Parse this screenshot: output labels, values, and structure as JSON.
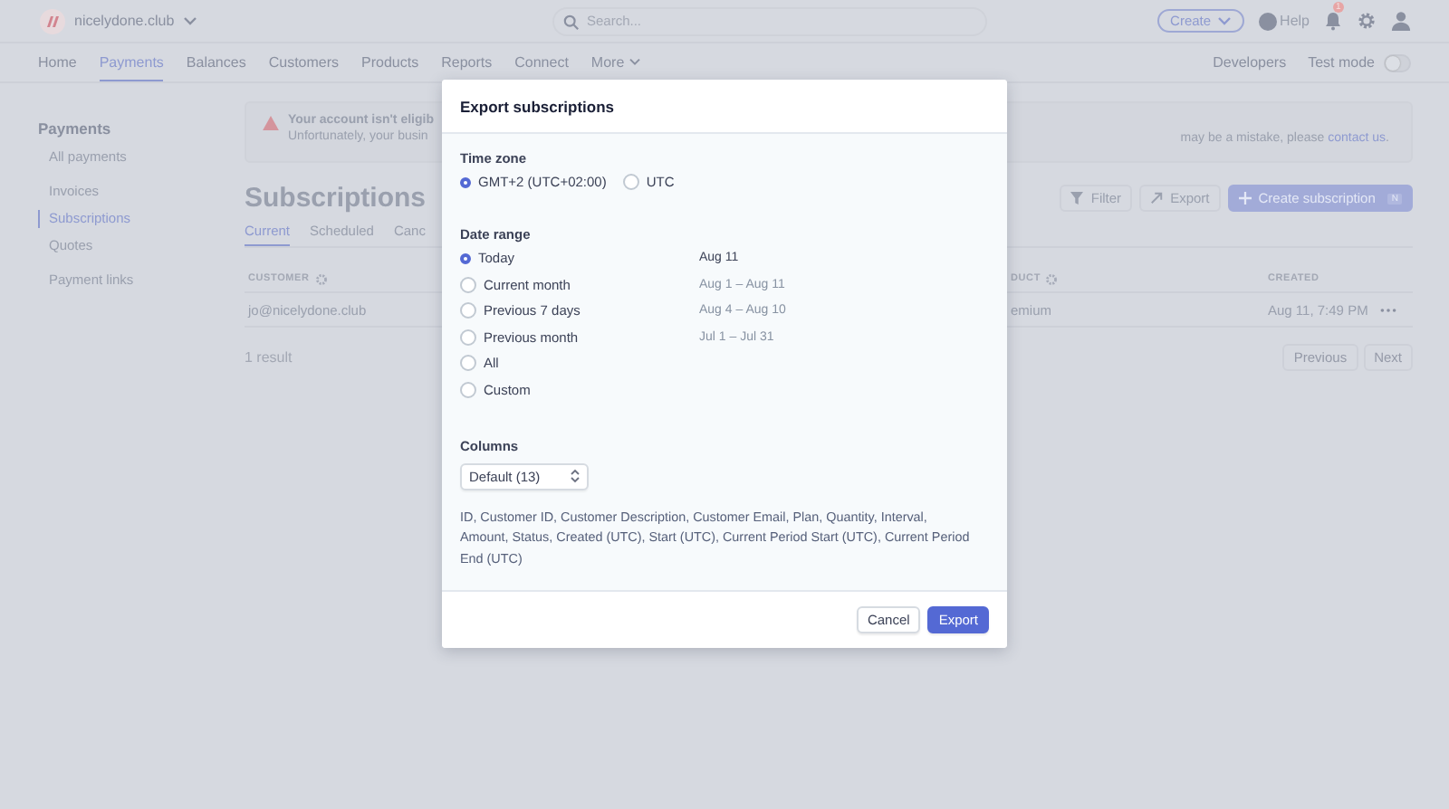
{
  "topbar": {
    "account": "nicelydone.club",
    "search_placeholder": "Search...",
    "create": "Create",
    "help": "Help",
    "notifications": "1"
  },
  "nav": {
    "items": [
      {
        "label": "Home",
        "selected": false
      },
      {
        "label": "Payments",
        "selected": true
      },
      {
        "label": "Balances",
        "selected": false
      },
      {
        "label": "Customers",
        "selected": false
      },
      {
        "label": "Products",
        "selected": false
      },
      {
        "label": "Reports",
        "selected": false
      },
      {
        "label": "Connect",
        "selected": false
      },
      {
        "label": "More",
        "selected": false
      }
    ],
    "developers": "Developers",
    "test_mode": {
      "label": "Test mode",
      "on": false
    }
  },
  "sidebar": {
    "title": "Payments",
    "groups": [
      [
        {
          "label": "All payments",
          "selected": false
        }
      ],
      [
        {
          "label": "Invoices",
          "selected": false
        },
        {
          "label": "Subscriptions",
          "selected": true
        },
        {
          "label": "Quotes",
          "selected": false
        }
      ],
      [
        {
          "label": "Payment links",
          "selected": false
        }
      ]
    ]
  },
  "banner": {
    "title": "Your account isn't eligib",
    "body": "Unfortunately, your busin",
    "body_end": "may be a mistake, please",
    "link": "contact us",
    "after_link": "."
  },
  "page": {
    "title": "Subscriptions",
    "tabs": [
      {
        "label": "Current",
        "selected": true
      },
      {
        "label": "Scheduled",
        "selected": false
      },
      {
        "label": "Canc",
        "selected": false
      }
    ],
    "filter": "Filter",
    "export": "Export",
    "create": "Create subscription",
    "shortcut": "N"
  },
  "table": {
    "columns": [
      {
        "label": "CUSTOMER",
        "info": true
      },
      {
        "label": "DUCT",
        "info": true
      },
      {
        "label": "CREATED",
        "info": false
      }
    ],
    "rows": [
      [
        "jo@nicelydone.club",
        "emium",
        "Aug 11, 7:49 PM"
      ]
    ],
    "result_count": "1 result",
    "pagination": [
      {
        "label": "Previous",
        "disabled": true
      },
      {
        "label": "Next",
        "disabled": true
      }
    ]
  },
  "modal": {
    "title": "Export subscriptions",
    "time_zone": {
      "label": "Time zone",
      "options": [
        {
          "label": "GMT+2 (UTC+02:00)",
          "selected": true
        },
        {
          "label": "UTC",
          "selected": false
        }
      ]
    },
    "date_range": {
      "label": "Date range",
      "options": [
        {
          "label": "Today",
          "range": "Aug 11",
          "selected": true
        },
        {
          "label": "Current month",
          "range": "Aug 1 – Aug 11",
          "selected": false
        },
        {
          "label": "Previous 7 days",
          "range": "Aug 4 – Aug 10",
          "selected": false
        },
        {
          "label": "Previous month",
          "range": "Jul 1 – Jul 31",
          "selected": false
        },
        {
          "label": "All",
          "selected": false
        },
        {
          "label": "Custom",
          "selected": false
        }
      ]
    },
    "columns": {
      "label": "Columns",
      "select": "Default (13)",
      "description": "ID, Customer ID, Customer Description, Customer Email, Plan, Quantity, Interval, Amount, Status, Created (UTC), Start (UTC), Current Period Start (UTC), Current Period End (UTC)"
    },
    "buttons": [
      {
        "label": "Cancel",
        "kind": "secondary"
      },
      {
        "label": "Export",
        "kind": "primary"
      }
    ]
  }
}
